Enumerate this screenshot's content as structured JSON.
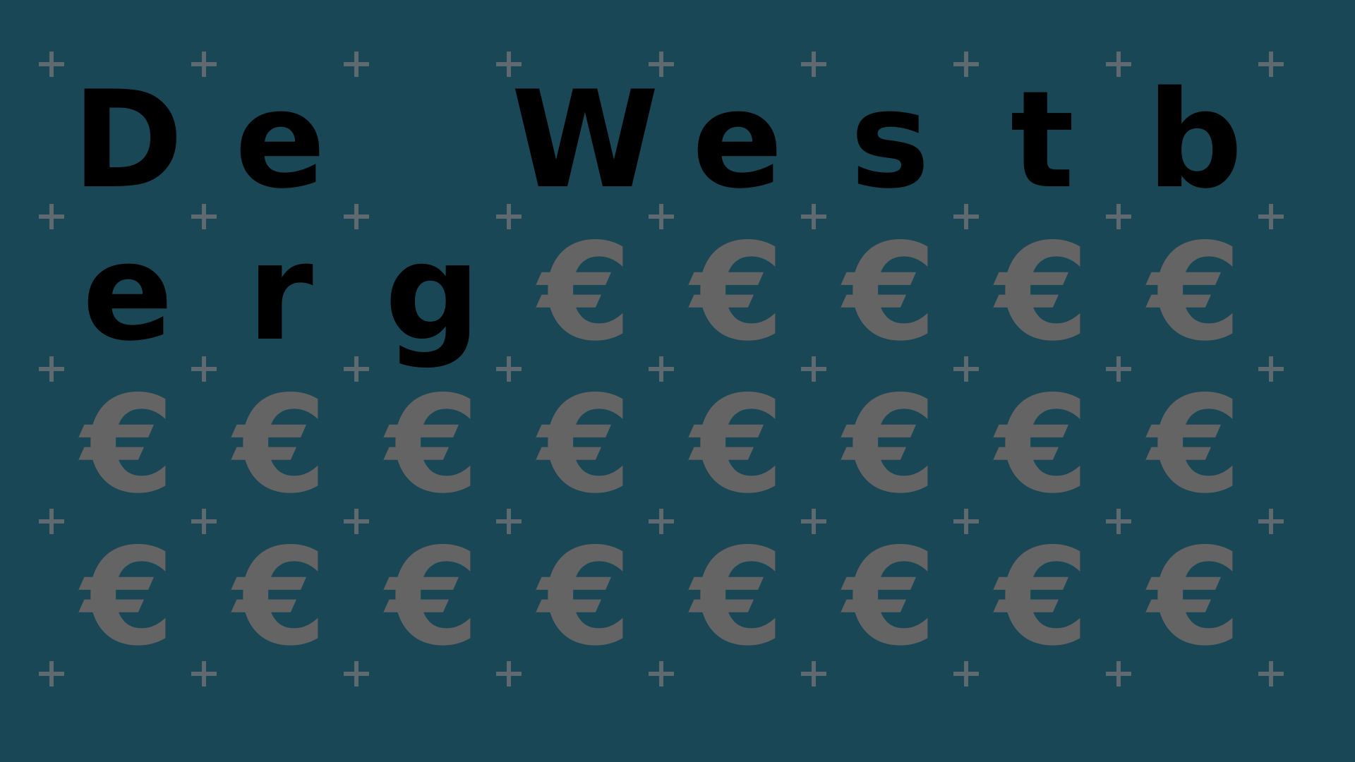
{
  "puzzle": {
    "letters": [
      "D",
      "e",
      "",
      "W",
      "e",
      "s",
      "t",
      "b",
      "e",
      "r",
      "g"
    ],
    "hidden_symbol": "€",
    "total_tiles": 32
  },
  "colors": {
    "background": "#194756",
    "revealed_letter": "#000000",
    "hidden_tile": "#646464",
    "grid_marker": "#5f6a70"
  }
}
